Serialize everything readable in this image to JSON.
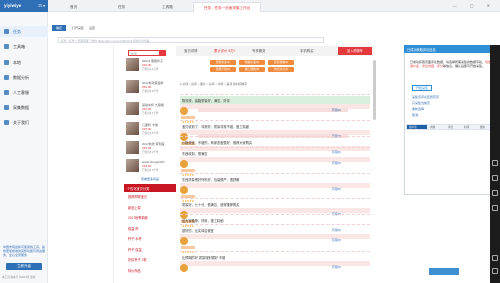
{
  "app": {
    "brand": "yiyiwiye",
    "brand_extra": "⊡ ▾"
  },
  "sidebar": {
    "items": [
      {
        "label": "任务",
        "active": true
      },
      {
        "label": "工具箱"
      },
      {
        "label": "本地"
      },
      {
        "label": "数据分析"
      },
      {
        "label": "人工客服"
      },
      {
        "label": "采集数据"
      },
      {
        "label": "关于我们"
      }
    ],
    "notice": "中国市场最新可使用的工具，提供更加成熟的完整功能与周边服务，全心全意服务",
    "cta": "立即升级",
    "footer": "本工具 版本号 2018 6月 更新"
  },
  "tabs": [
    "首页",
    "任务",
    "工具箱",
    "任务 - 任务一页面采集工作台"
  ],
  "window_controls": "— ▢ ✕",
  "toolbar": {
    "confirm": "确定",
    "open": "打开采集",
    "settings": "设置"
  },
  "address": "任务 - 任务一页面采集工作台 https://item.jd.com/100.html 评论信息查看",
  "webpage": {
    "search_placeholder": "搜索",
    "nav": [
      "宝贝详情",
      "累计评价 8万+",
      "专享服务",
      "手机购买"
    ],
    "cart": "加入购物车",
    "tags": [
      "优惠多多(1)",
      "物美价廉(2)",
      "配货准确(3)",
      "质量不错(4)",
      "做工细致(5)",
      "款式漂亮(6)"
    ],
    "filter": "● 全部  ○ 追评  ○ 图片  ○ 好评  ○ 中评  ○ 差评    按时间排序",
    "products": [
      {
        "name": "200ml 便携杯子",
        "price": "¥39.00",
        "sold": "已售出1.2万件"
      },
      {
        "name": "2017新款保温杯",
        "price": "¥59.00",
        "sold": "已售出9.8千件"
      },
      {
        "name": "运动水杯 大容量",
        "price": "¥29.00",
        "sold": "已售出3.1千件"
      },
      {
        "name": "儿童杯 卡通",
        "price": "¥25.00",
        "sold": "已售出1.5千件"
      },
      {
        "name": "2017新款 带刻度",
        "price": "¥45.00",
        "sold": "已售出6.2千件"
      },
      {
        "name": "ankle zhang2017",
        "price": "¥49.00",
        "sold": "已售出2.0千件"
      }
    ],
    "more_link": "查看更多商品",
    "category_head": "个性化宝贝分类",
    "categories": [
      "推荐购物宝贝",
      "新品上架",
      "2017秋季新款",
      "保温 杯",
      "杯子 水杯",
      "杯子 保温",
      "折扣杯子 7款",
      "特价商品"
    ],
    "reviews": [
      {
        "text": "物流快，装箱质量好，满意，好评"
      },
      {
        "text": "宝贝收到了，非常好，质量非常不错，做工精细"
      },
      {
        "text": "价格便宜，不错的，商家态度很好，推荐大家购买"
      },
      {
        "text": "东西收到，很满意"
      },
      {
        "text": "东西质量很好外形好，包装很严，很舒服"
      },
      {
        "text": "质量好，七十分，很满意，值得推荐购买"
      },
      {
        "text": "给大家推荐，好用，做工精细"
      },
      {
        "text": "挺好的，比实体店便宜"
      },
      {
        "text": "比预期的好 质量特别很好 不错"
      }
    ],
    "review_more": "有用(0)"
  },
  "popup": {
    "title": "已成功获取评论信息",
    "body_1": "已成功获取页面评论数据，请选择所需采集的数据字段，",
    "body_hl": "包含用户名、评论内容、评分",
    "body_2": "等信息，确认后即可开始采集。",
    "button": "开始采集",
    "links": [
      "采集该评论区所有页",
      "只采集当前页",
      "重新选择",
      "取消"
    ],
    "cells": [
      "用户名",
      "内容",
      "评分",
      "时间",
      "图片"
    ]
  }
}
